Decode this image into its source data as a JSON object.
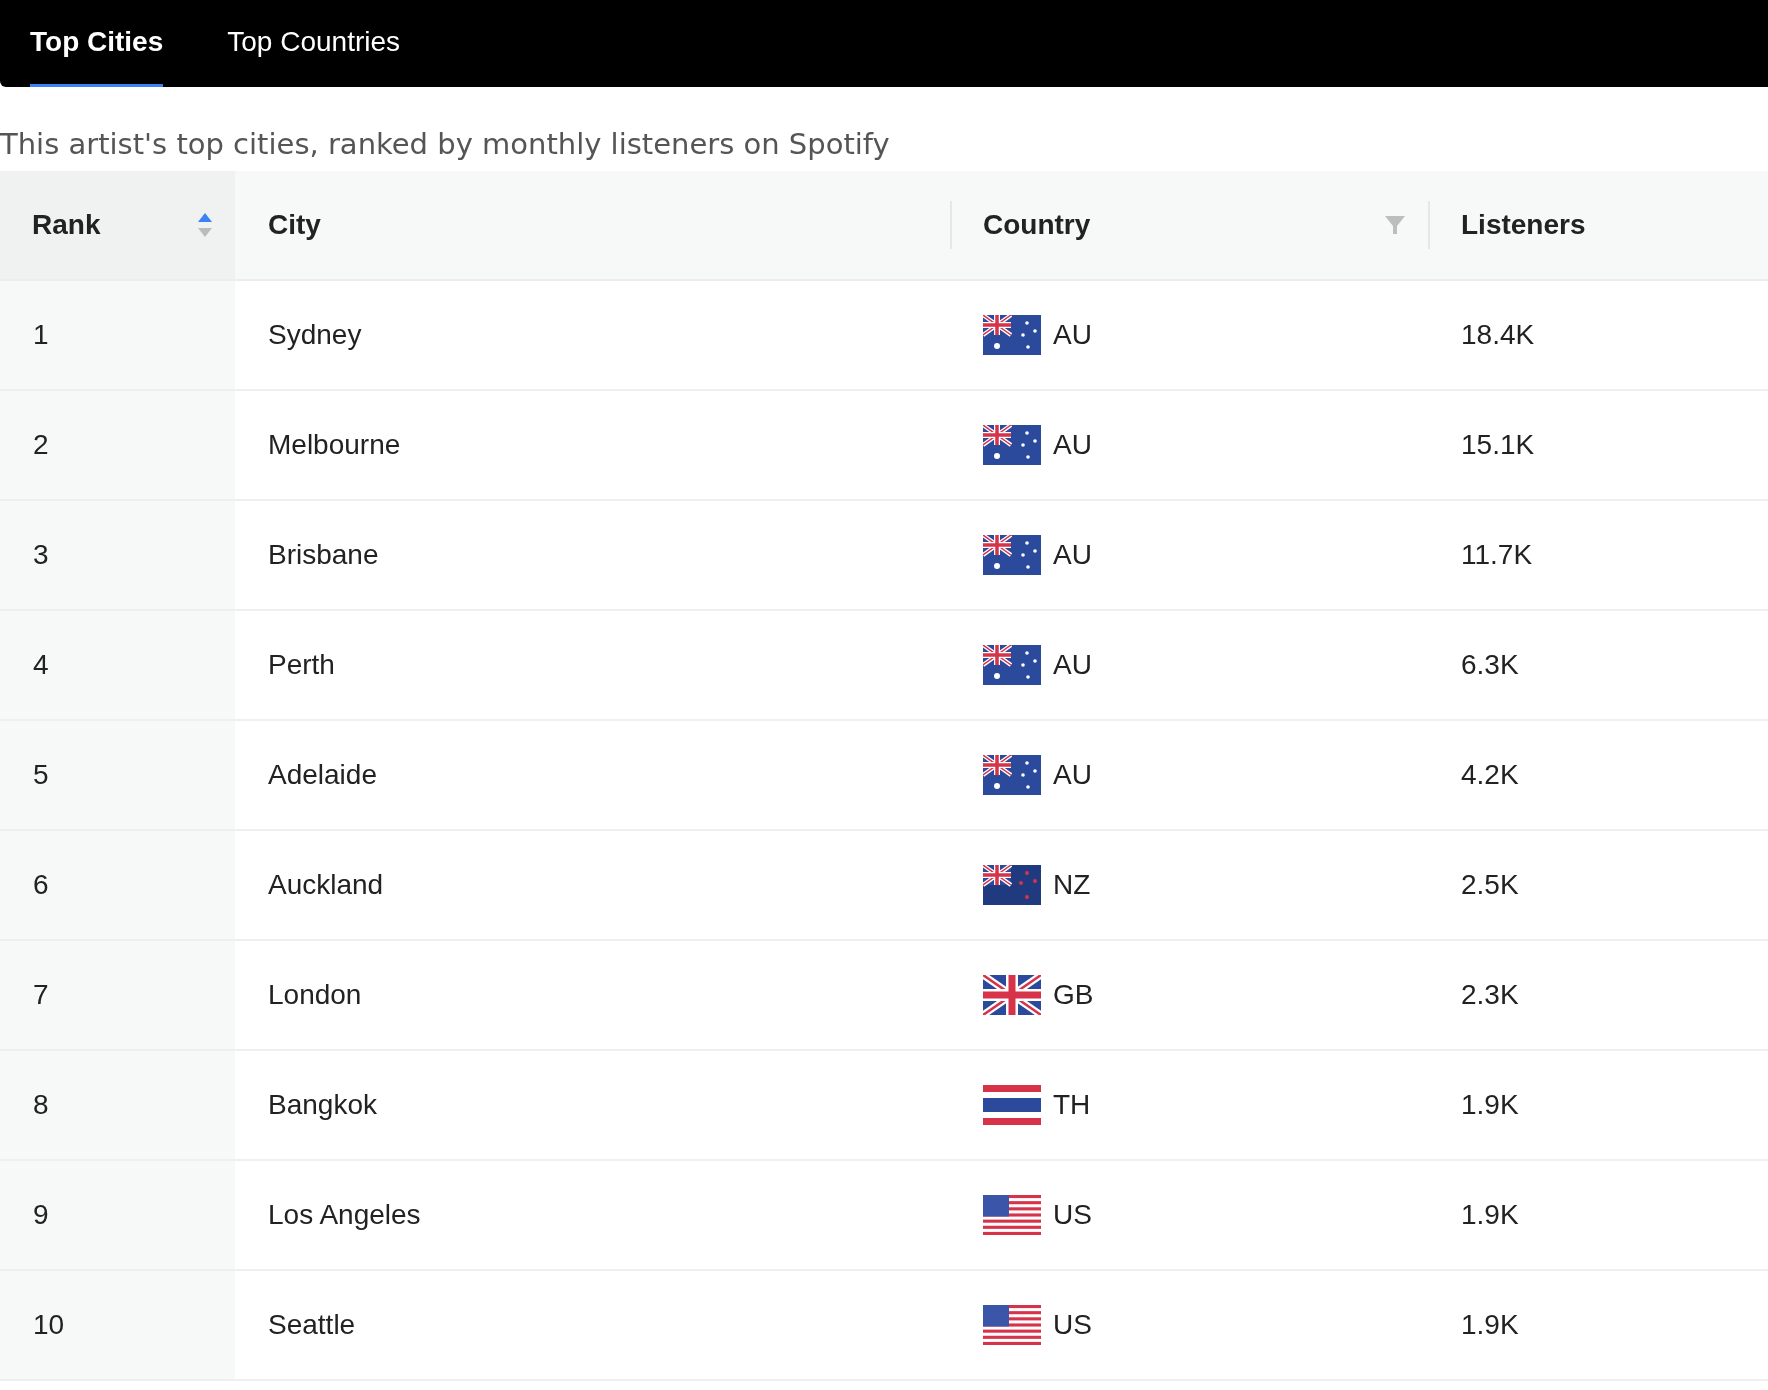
{
  "tabs": [
    {
      "label": "Top Cities",
      "selected": true
    },
    {
      "label": "Top Countries",
      "selected": false
    }
  ],
  "caption": "This artist's top cities, ranked by monthly listeners on Spotify",
  "table": {
    "columns": [
      {
        "label": "Rank",
        "sorted": true,
        "filter": false
      },
      {
        "label": "City",
        "sorted": false,
        "filter": false
      },
      {
        "label": "Country",
        "sorted": false,
        "filter": true
      },
      {
        "label": "Listeners",
        "sorted": false,
        "filter": false
      }
    ],
    "rows": [
      {
        "rank": "1",
        "city": "Sydney",
        "kind": "au",
        "country": "AU",
        "listeners": "18.4K"
      },
      {
        "rank": "2",
        "city": "Melbourne",
        "kind": "au",
        "country": "AU",
        "listeners": "15.1K"
      },
      {
        "rank": "3",
        "city": "Brisbane",
        "kind": "au",
        "country": "AU",
        "listeners": "11.7K"
      },
      {
        "rank": "4",
        "city": "Perth",
        "kind": "au",
        "country": "AU",
        "listeners": "6.3K"
      },
      {
        "rank": "5",
        "city": "Adelaide",
        "kind": "au",
        "country": "AU",
        "listeners": "4.2K"
      },
      {
        "rank": "6",
        "city": "Auckland",
        "kind": "nz",
        "country": "NZ",
        "listeners": "2.5K"
      },
      {
        "rank": "7",
        "city": "London",
        "kind": "gb",
        "country": "GB",
        "listeners": "2.3K"
      },
      {
        "rank": "8",
        "city": "Bangkok",
        "kind": "th",
        "country": "TH",
        "listeners": "1.9K"
      },
      {
        "rank": "9",
        "city": "Los Angeles",
        "kind": "us",
        "country": "US",
        "listeners": "1.9K"
      },
      {
        "rank": "10",
        "city": "Seattle",
        "kind": "us",
        "country": "US",
        "listeners": "1.9K"
      }
    ]
  }
}
